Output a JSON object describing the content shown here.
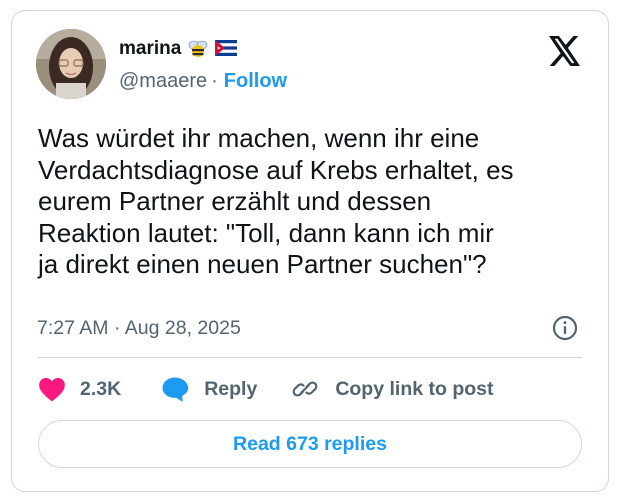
{
  "author": {
    "display_name": "marina",
    "handle": "@maaere",
    "separator": "·",
    "follow_label": "Follow",
    "emojis": [
      "bee-emoji",
      "cuba-flag-emoji"
    ]
  },
  "tweet": {
    "text": "Was würdet ihr machen, wenn ihr eine\nVerdachtsdiagnose auf Krebs erhaltet, es\neurem Partner erzählt und dessen\nReaktion lautet: \"Toll, dann kann ich mir\nja direkt einen neuen Partner suchen\"?",
    "timestamp": "7:27 AM · Aug 28, 2025"
  },
  "actions": {
    "likes_count": "2.3K",
    "reply_label": "Reply",
    "copy_label": "Copy link to post"
  },
  "read_replies_label": "Read 673 replies",
  "icons": {
    "logo": "x-logo-icon",
    "info": "info-icon",
    "like": "heart-icon",
    "reply": "speech-bubble-icon",
    "copy": "link-icon"
  },
  "colors": {
    "accent": "#1d9bf0",
    "like": "#f91880",
    "secondary_text": "#536471",
    "border": "#cfd9de",
    "text": "#0f1419"
  }
}
